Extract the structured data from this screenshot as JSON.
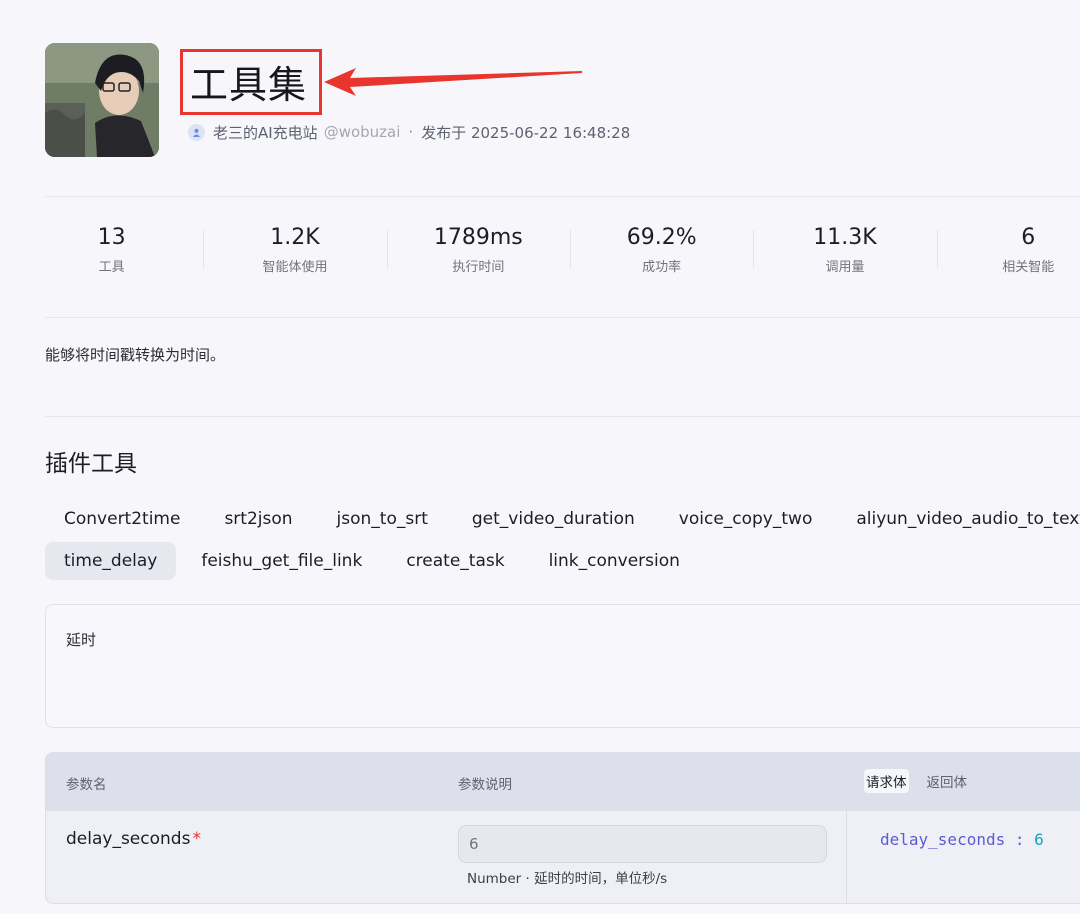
{
  "header": {
    "title": "工具集",
    "author": "老三的AI充电站",
    "handle": "@wobuzai",
    "dot": "·",
    "published": "发布于 2025-06-22 16:48:28"
  },
  "stats": [
    {
      "value": "13",
      "label": "工具"
    },
    {
      "value": "1.2K",
      "label": "智能体使用"
    },
    {
      "value": "1789ms",
      "label": "执行时间"
    },
    {
      "value": "69.2%",
      "label": "成功率"
    },
    {
      "value": "11.3K",
      "label": "调用量"
    },
    {
      "value": "6",
      "label": "相关智能"
    }
  ],
  "description": "能够将时间戳转换为时间。",
  "section_title": "插件工具",
  "tools": {
    "row1": [
      "Convert2time",
      "srt2json",
      "json_to_srt",
      "get_video_duration",
      "voice_copy_two",
      "aliyun_video_audio_to_text"
    ],
    "row2": [
      "time_delay",
      "feishu_get_file_link",
      "create_task",
      "link_conversion"
    ],
    "active": "time_delay"
  },
  "tool_description": "延时",
  "params": {
    "headers": {
      "name": "参数名",
      "desc": "参数说明"
    },
    "body_tabs": [
      "请求体",
      "返回体"
    ],
    "rows": [
      {
        "name": "delay_seconds",
        "required": "*",
        "placeholder": "6",
        "hint": "Number · 延时的时间，单位秒/s"
      }
    ],
    "json_key": "delay_seconds",
    "json_sep": " : ",
    "json_value": "6"
  },
  "colors": {
    "annotation": "#e8362f",
    "json_key": "#5b5bd6",
    "json_value": "#17a3c4"
  }
}
